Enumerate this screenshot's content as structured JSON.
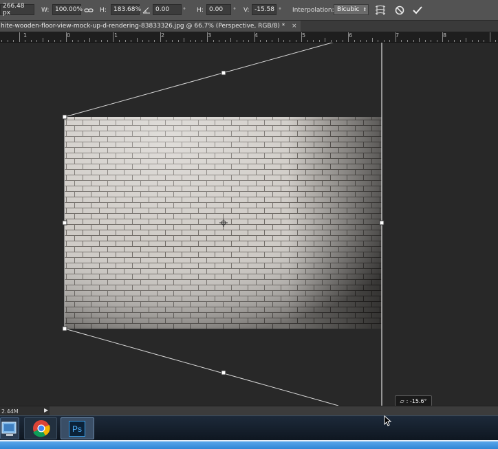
{
  "options_bar": {
    "x_value": "266.48 px",
    "w_label": "W:",
    "w_value": "100.00%",
    "h_label": "H:",
    "h_value": "183.68%",
    "rotate_value": "0.00",
    "degree_symbol": "°",
    "skew_h_label": "H:",
    "skew_h_value": "0.00",
    "skew_v_label": "V:",
    "skew_v_value": "-15.58",
    "interpolation_label": "Interpolation:",
    "interpolation_value": "Bicubic"
  },
  "document_tab": {
    "title": "hite-wooden-floor-view-mock-up-d-rendering-83833326.jpg @ 66.7% (Perspective, RGB/8) *",
    "close": "×"
  },
  "ruler": {
    "labels": [
      "1",
      "0",
      "1",
      "2",
      "3",
      "4",
      "5",
      "6",
      "7",
      "8"
    ]
  },
  "status_bar": {
    "doc_size": "2.44M",
    "arrow": "▶"
  },
  "angle_tooltip": {
    "text": ": -15.6°"
  },
  "taskbar": {
    "ps_label": "Ps"
  },
  "colors": {
    "panel": "#535353",
    "canvas_bg": "#282828",
    "guide": "#d8d8d8"
  }
}
